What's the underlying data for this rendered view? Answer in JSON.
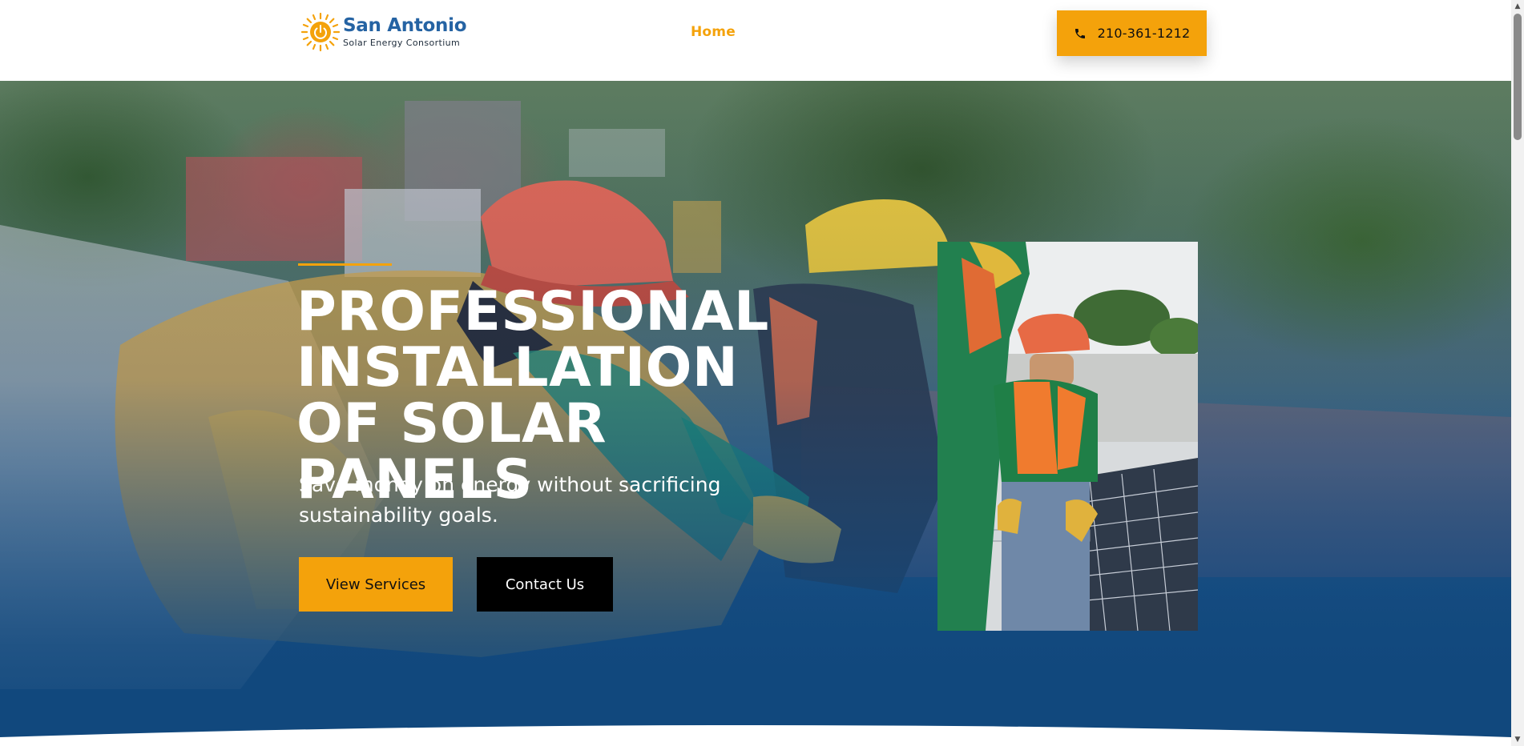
{
  "header": {
    "logo": {
      "title": "San Antonio",
      "subtitle": "Solar Energy Consortium",
      "icon": "sun-power-icon"
    },
    "nav": {
      "home_label": "Home"
    },
    "phone": {
      "icon": "phone-icon",
      "label": "210-361-1212"
    }
  },
  "hero": {
    "title": "PROFESSIONAL INSTALLATION OF SOLAR PANELS",
    "subtitle": "Save money on energy without sacrificing sustainability goals.",
    "buttons": {
      "services_label": "View Services",
      "contact_label": "Contact Us"
    }
  },
  "colors": {
    "accent": "#f4a20b",
    "brand_blue": "#2563a3",
    "hero_blue": "#134a7e",
    "contact_button": "#000000"
  }
}
